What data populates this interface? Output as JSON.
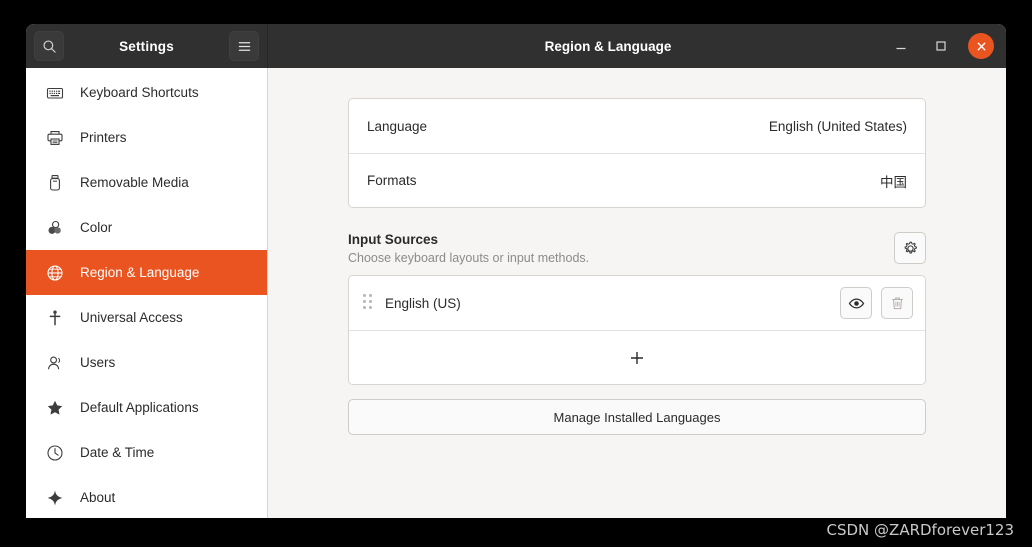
{
  "window": {
    "app_title": "Settings",
    "page_title": "Region & Language",
    "search_icon": "search-icon",
    "menu_icon": "hamburger-menu-icon",
    "minimize_label": "–",
    "maximize_label": "□",
    "close_label": "✕",
    "accent_color": "#E95420",
    "titlebar_color": "#303030"
  },
  "sidebar": {
    "items": [
      {
        "label": "Keyboard Shortcuts",
        "icon": "keyboard-icon",
        "active": false
      },
      {
        "label": "Printers",
        "icon": "printer-icon",
        "active": false
      },
      {
        "label": "Removable Media",
        "icon": "usb-drive-icon",
        "active": false
      },
      {
        "label": "Color",
        "icon": "color-circles-icon",
        "active": false
      },
      {
        "label": "Region & Language",
        "icon": "globe-icon",
        "active": true
      },
      {
        "label": "Universal Access",
        "icon": "accessibility-icon",
        "active": false
      },
      {
        "label": "Users",
        "icon": "users-icon",
        "active": false
      },
      {
        "label": "Default Applications",
        "icon": "star-icon",
        "active": false
      },
      {
        "label": "Date & Time",
        "icon": "clock-icon",
        "active": false
      },
      {
        "label": "About",
        "icon": "sparkle-icon",
        "active": false
      }
    ]
  },
  "main": {
    "language_row": {
      "label": "Language",
      "value": "English (United States)"
    },
    "formats_row": {
      "label": "Formats",
      "value": "中国"
    },
    "input_sources": {
      "title": "Input Sources",
      "subtitle": "Choose keyboard layouts or input methods.",
      "settings_icon": "gear-icon",
      "sources": [
        {
          "name": "English (US)",
          "drag_handle_icon": "drag-handle-icon",
          "preview_icon": "eye-icon",
          "remove_icon": "trash-icon"
        }
      ],
      "add_label": "+",
      "add_icon": "plus-icon"
    },
    "manage_button": "Manage Installed Languages"
  },
  "watermark": "CSDN @ZARDforever123"
}
